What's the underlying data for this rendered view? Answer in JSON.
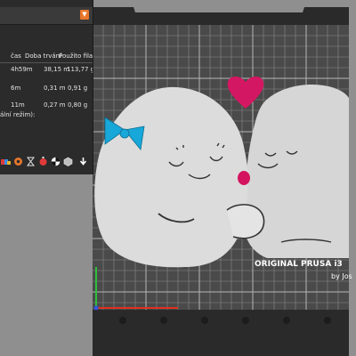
{
  "info_table": {
    "headers": {
      "time": "čas",
      "duration": "Doba trvání",
      "filament": "Použito filamentu"
    },
    "rows": [
      {
        "time": "4h59m",
        "length": "38,15 m",
        "weight": "113,77 g"
      },
      {
        "time": "6m",
        "length": "0,31 m",
        "weight": "0,91 g"
      },
      {
        "time": "11m",
        "length": "0,27 m",
        "weight": "0,80 g"
      }
    ],
    "footnote": "ální režim):"
  },
  "bed": {
    "label_line1": "ORIGINAL PRUSA i3",
    "label_line2": "by Jos"
  },
  "colors": {
    "panel_bg": "#2b2b2b",
    "accent": "#e8762b",
    "bed_bg": "#4a4a4a",
    "model_white": "#d8d8d8",
    "bow": "#1aa6d6",
    "heart": "#d9146d"
  },
  "icons": [
    "color-change-icon",
    "filament-icon",
    "hourglass-icon",
    "timer-icon",
    "checker-icon",
    "cube-icon",
    "export-arrow-icon"
  ]
}
